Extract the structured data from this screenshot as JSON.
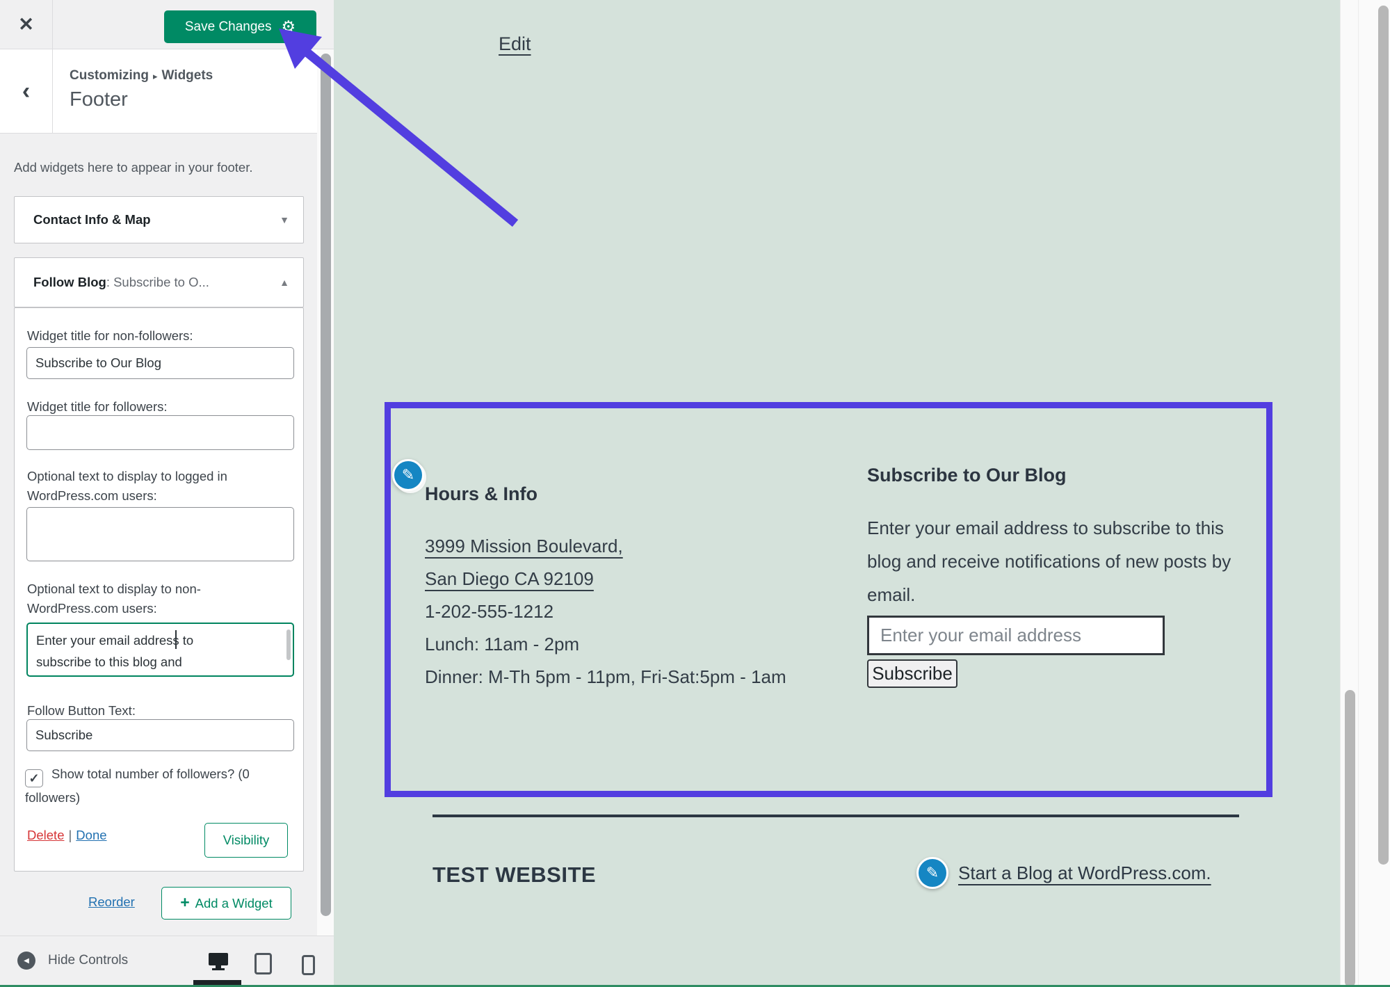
{
  "colors": {
    "accent_blue": "#523ee0",
    "wp_green": "#008a64",
    "preview_background": "#d5e2db",
    "link_blue": "#2271b1",
    "delete_red": "#d63638"
  },
  "icons": {
    "close": "✕",
    "back": "‹",
    "gear": "⚙",
    "breadcrumb_sep": "▸",
    "chevron_down": "▼",
    "chevron_up": "▲",
    "check": "✓",
    "plus": "+",
    "circle_back": "◀",
    "pencil": "✎"
  },
  "sidebar": {
    "topbar": {
      "save_label": "Save Changes"
    },
    "header": {
      "breadcrumb_root": "Customizing",
      "breadcrumb_section": "Widgets",
      "title": "Footer"
    },
    "description": "Add widgets here to appear in your footer.",
    "widgets": {
      "collapsed": {
        "title": "Contact Info & Map"
      },
      "expanded": {
        "title_bold": "Follow Blog",
        "title_rest": ": Subscribe to O...",
        "fields": [
          {
            "label": "Widget title for non-followers:",
            "value": "Subscribe to Our Blog"
          },
          {
            "label": "Widget title for followers:",
            "value": ""
          },
          {
            "label": "Optional text to display to logged in WordPress.com users:",
            "value": ""
          },
          {
            "label": "Optional text to display to non-WordPress.com users:",
            "value": "Enter your email address to subscribe to this blog and"
          },
          {
            "label": "Follow Button Text:",
            "value": "Subscribe"
          }
        ],
        "followers_checkbox_label": "Show total number of followers? (0 followers)",
        "delete_label": "Delete",
        "links_separator": "|",
        "done_label": "Done",
        "visibility_label": "Visibility"
      }
    },
    "reorder_label": "Reorder",
    "add_widget_label": "Add a Widget",
    "controls": {
      "hide_label": "Hide Controls"
    }
  },
  "preview": {
    "edit_label": "Edit",
    "hours": {
      "title": "Hours & Info",
      "address_line1": "3999 Mission Boulevard,",
      "address_line2": "San Diego CA 92109",
      "phone": "1-202-555-1212",
      "lunch": "Lunch: 11am - 2pm",
      "dinner": "Dinner: M-Th 5pm - 11pm, Fri-Sat:5pm - 1am"
    },
    "subscribe": {
      "title": "Subscribe to Our Blog",
      "text": "Enter your email address to subscribe to this blog and receive notifications of new posts by email.",
      "input_placeholder": "Enter your email address",
      "button_label": "Subscribe"
    },
    "site_title": "TEST WEBSITE",
    "blog_link_label": "Start a Blog at WordPress.com."
  }
}
